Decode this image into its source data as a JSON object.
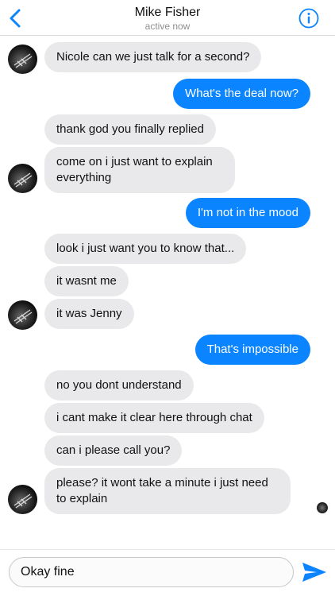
{
  "header": {
    "contact_name": "Mike Fisher",
    "status": "active now",
    "back_icon": "chevron-left-icon",
    "info_icon": "info-icon",
    "accent": "#0a84ff"
  },
  "messages": [
    {
      "from": "them",
      "text": "Nicole can we just talk for a second?"
    },
    {
      "from": "me",
      "text": "What's the deal now?"
    },
    {
      "from": "them",
      "text": "thank god you finally replied"
    },
    {
      "from": "them",
      "text": "come on i just want to explain everything"
    },
    {
      "from": "me",
      "text": "I'm not in the mood"
    },
    {
      "from": "them",
      "text": "look i just want you to know that..."
    },
    {
      "from": "them",
      "text": "it wasnt me"
    },
    {
      "from": "them",
      "text": "it was Jenny"
    },
    {
      "from": "me",
      "text": "That's impossible"
    },
    {
      "from": "them",
      "text": "no you dont understand"
    },
    {
      "from": "them",
      "text": "i cant make it clear here through chat"
    },
    {
      "from": "them",
      "text": "can i please call you?"
    },
    {
      "from": "them",
      "text": "please? it wont take a minute i just need to explain"
    }
  ],
  "composer": {
    "value": "Okay fine",
    "send_icon": "send-icon"
  },
  "colors": {
    "incoming_bubble": "#e9e9eb",
    "outgoing_bubble": "#0a84ff"
  }
}
